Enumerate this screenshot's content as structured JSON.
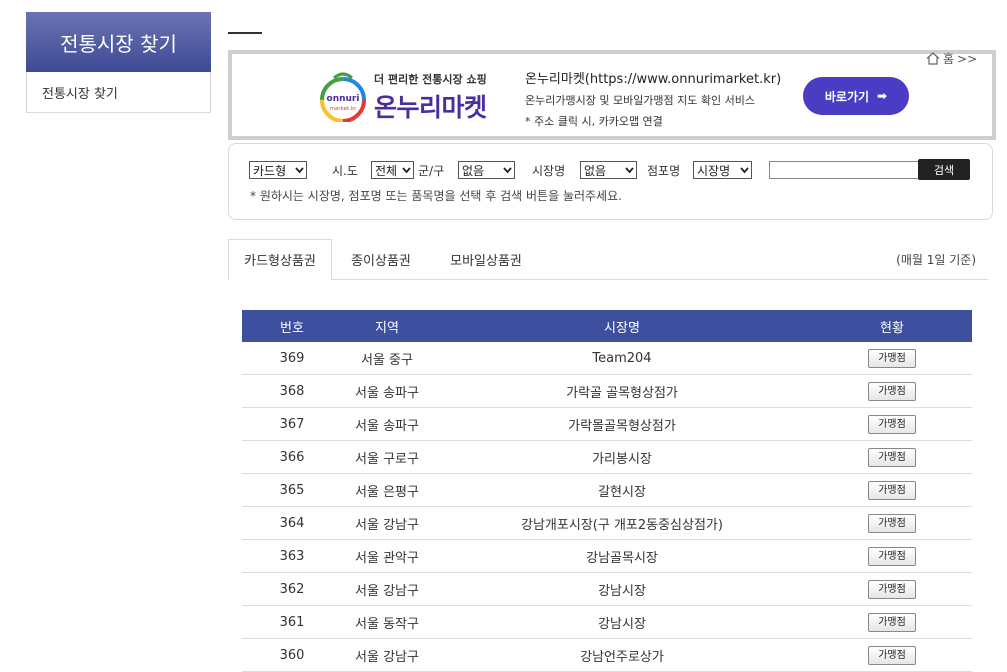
{
  "sidebar": {
    "heading": "전통시장 찾기",
    "items": [
      {
        "label": "전통시장 찾기"
      }
    ]
  },
  "breadcrumb": {
    "home_label": "홈",
    "separators": ">>"
  },
  "banner": {
    "logo_tagline": "더 편리한 전통시장 쇼핑",
    "logo_name": "온누리마켓",
    "logo_badge_top": "onnuri",
    "logo_badge_bottom": "market.kr",
    "title": "온누리마켓(https://www.onnurimarket.kr)",
    "subtitle": "온누리가맹시장 및 모바일가맹점 지도 확인 서비스",
    "note": "* 주소 클릭 시, 카카오맵 연결",
    "button_label": "바로가기",
    "button_arrow": "➡"
  },
  "search": {
    "card_type": "카드형",
    "sido_label": "시.도",
    "sido_value": "전체",
    "gugun_label": "군/구",
    "gugun_value": "없음",
    "market_label": "시장명",
    "market_value": "없음",
    "store_label": "점포명",
    "field_value": "시장명",
    "keyword": "",
    "button_label": "검색",
    "hint": "* 원하시는 시장명, 점포명 또는 품목명을 선택 후 검색 버튼을 눌러주세요."
  },
  "tabs": [
    {
      "label": "카드형상품권",
      "active": true
    },
    {
      "label": "종이상품권",
      "active": false
    },
    {
      "label": "모바일상품권",
      "active": false
    }
  ],
  "basis_note": "(매월 1일 기준)",
  "table": {
    "headers": [
      "번호",
      "지역",
      "시장명",
      "현황"
    ],
    "button_label": "가맹점",
    "rows": [
      {
        "no": "369",
        "region": "서울 중구",
        "market": "Team204"
      },
      {
        "no": "368",
        "region": "서울 송파구",
        "market": "가락골 골목형상점가"
      },
      {
        "no": "367",
        "region": "서울 송파구",
        "market": "가락몰골목형상점가"
      },
      {
        "no": "366",
        "region": "서울 구로구",
        "market": "가리봉시장"
      },
      {
        "no": "365",
        "region": "서울 은평구",
        "market": "갈현시장"
      },
      {
        "no": "364",
        "region": "서울 강남구",
        "market": "강남개포시장(구 개포2동중심상점가)"
      },
      {
        "no": "363",
        "region": "서울 관악구",
        "market": "강남골목시장"
      },
      {
        "no": "362",
        "region": "서울 강남구",
        "market": "강남시장"
      },
      {
        "no": "361",
        "region": "서울 동작구",
        "market": "강남시장"
      },
      {
        "no": "360",
        "region": "서울 강남구",
        "market": "강남언주로상가"
      }
    ]
  },
  "colors": {
    "header_blue": "#3f4fa0",
    "button_purple": "#4b3cc4",
    "logo_text": "#4a2da0"
  }
}
